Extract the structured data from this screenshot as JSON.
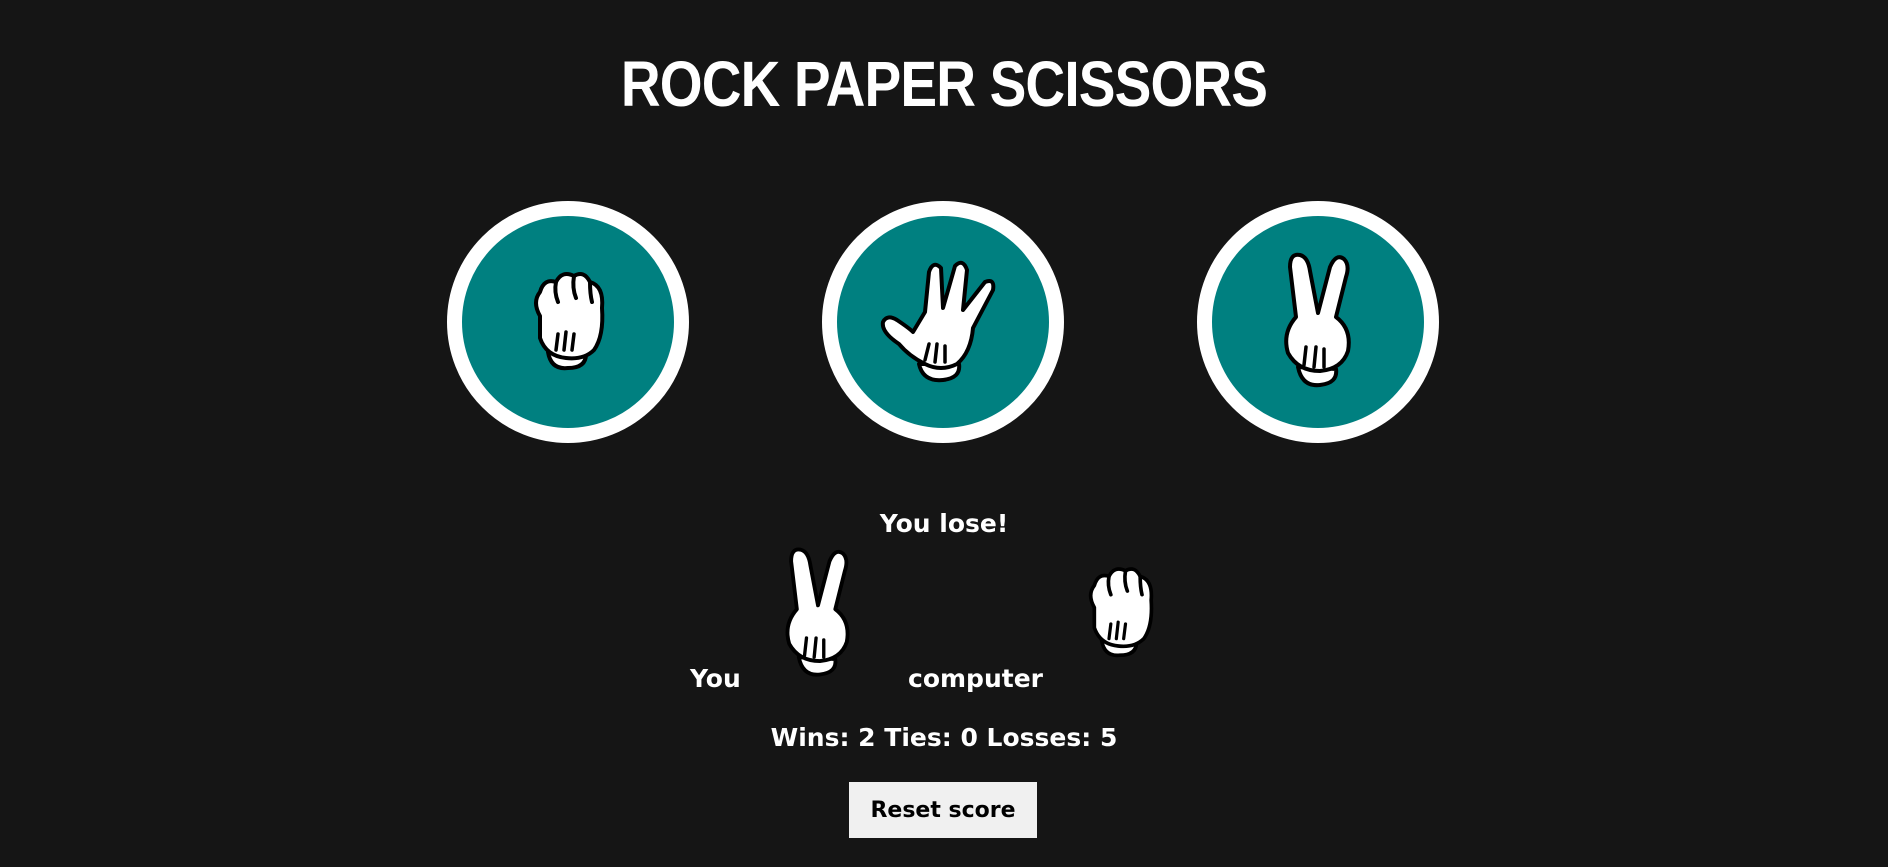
{
  "title": "ROCK PAPER SCISSORS",
  "choices": [
    {
      "id": "rock",
      "icon": "rock-hand-icon"
    },
    {
      "id": "paper",
      "icon": "paper-hand-icon"
    },
    {
      "id": "scissors",
      "icon": "scissors-hand-icon"
    }
  ],
  "result": {
    "message": "You lose!",
    "you_label": "You",
    "you_choice": "scissors",
    "computer_label": "computer",
    "computer_choice": "rock"
  },
  "score": {
    "text": "Wins: 2 Ties: 0 Losses: 5",
    "wins": 2,
    "ties": 0,
    "losses": 5
  },
  "reset_label": "Reset score",
  "colors": {
    "background": "#151515",
    "accent": "#008080",
    "text": "#ffffff",
    "button": "#f0f0f0"
  }
}
